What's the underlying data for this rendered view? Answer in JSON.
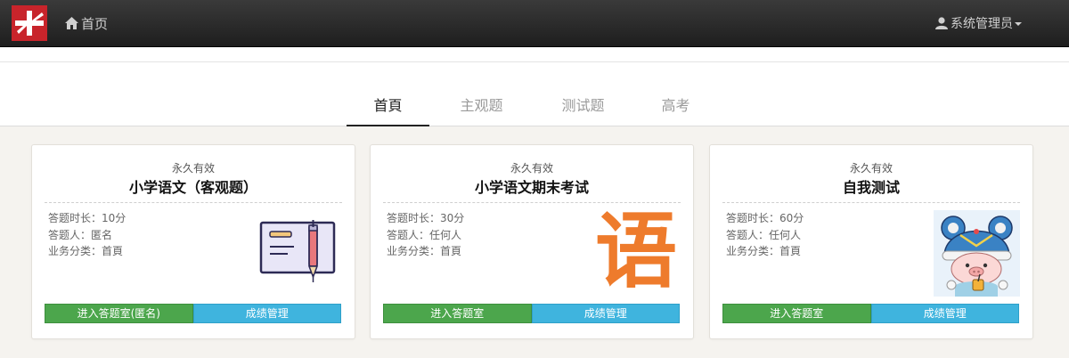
{
  "navbar": {
    "home_label": "首页",
    "user_label": "系统管理员",
    "logo_icon": "logo-icon",
    "colors": {
      "bar": "#2a2a2a",
      "logo": "#c8242b"
    }
  },
  "tabs": [
    {
      "label": "首頁",
      "active": true
    },
    {
      "label": "主观题",
      "active": false
    },
    {
      "label": "测试题",
      "active": false
    },
    {
      "label": "高考",
      "active": false
    }
  ],
  "cards": [
    {
      "validity": "永久有效",
      "title": "小学语文（客观题）",
      "info": [
        "答题时长：10分",
        "答题人：匿名",
        "业务分类：首頁"
      ],
      "enter_label": "进入答题室(匿名)",
      "score_label": "成绩管理",
      "image": "notebook-pen-icon"
    },
    {
      "validity": "永久有效",
      "title": "小学语文期末考试",
      "info": [
        "答题时长：30分",
        "答题人：任何人",
        "业务分类：首頁"
      ],
      "enter_label": "进入答题室",
      "score_label": "成绩管理",
      "image_text": "语"
    },
    {
      "validity": "永久有效",
      "title": "自我测试",
      "info": [
        "答题时长：60分",
        "答题人：任何人",
        "业务分类：首頁"
      ],
      "enter_label": "进入答题室",
      "score_label": "成绩管理",
      "image": "pig-avatar-icon"
    }
  ],
  "colors": {
    "enter": "#4ca64c",
    "score": "#3fb4de",
    "background": "#f5f3ef"
  }
}
